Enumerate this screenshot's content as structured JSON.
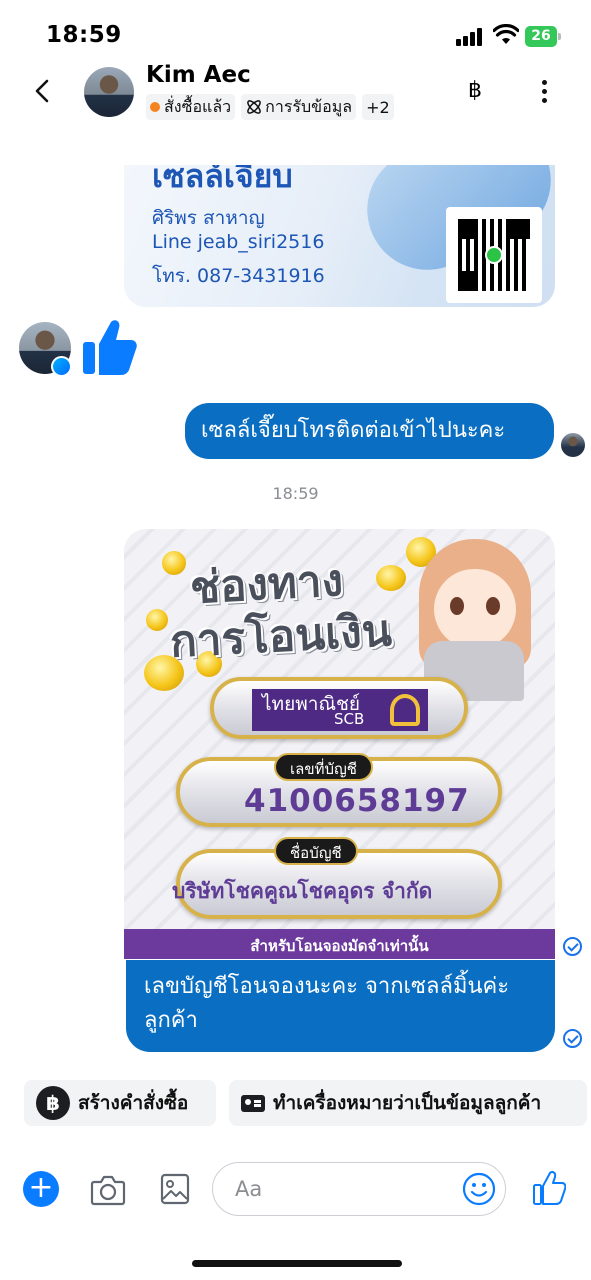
{
  "status_bar": {
    "time": "18:59",
    "battery": "26"
  },
  "header": {
    "contact_name": "Kim Aec",
    "tags": [
      {
        "label": "สั่งซื้อแล้ว"
      },
      {
        "label": "การรับข้อมูล"
      },
      {
        "label": "+2"
      }
    ],
    "baht_icon": "฿"
  },
  "card1": {
    "title": "เซลล์เจี๊ยบ",
    "name": "ศิริพร สาหาญ",
    "line": "Line  jeab_siri2516",
    "phone": "โทร. 087-3431916"
  },
  "messages": {
    "outgoing_1": "เซลล์เจี๊ยบโทรติดต่อเข้าไปนะคะ",
    "timestamp": "18:59",
    "outgoing_2": "เลขบัญชีโอนจองนะคะ จากเซลล์มิ้นค่ะ ลูกค้า"
  },
  "card2": {
    "heading_1": "ช่องทาง",
    "heading_2": "การโอนเงิน",
    "bank_th": "ไทยพาณิชย์",
    "bank_en": "SCB",
    "account_label": "เลขที่บัญชี",
    "account_number": "4100658197",
    "name_label": "ชื่อบัญชี",
    "account_name": "บริษัทโชคคูณโชคอุดร จำกัด",
    "footer": "สำหรับโอนจองมัดจำเท่านั้น"
  },
  "quick_actions": {
    "create_order": "สร้างคำสั่งซื้อ",
    "mark_customer": "ทำเครื่องหมายว่าเป็นข้อมูลลูกค้า"
  },
  "composer": {
    "placeholder": "Aa"
  },
  "colors": {
    "accent": "#0a7cff",
    "bubble": "#0a6fc2"
  }
}
